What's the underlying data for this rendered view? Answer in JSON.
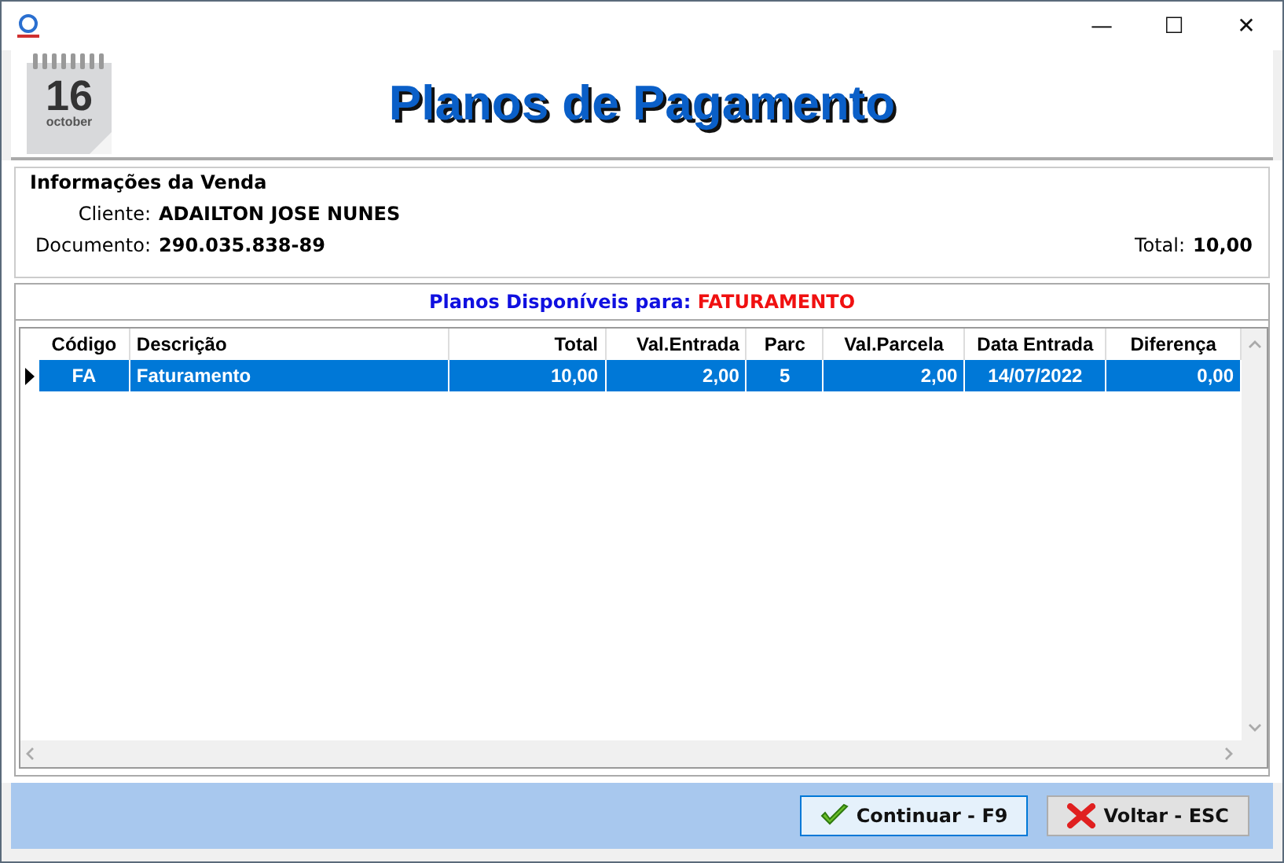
{
  "window": {
    "title": "Planos de Pagamento",
    "controls": [
      "—",
      "☐",
      "✕"
    ]
  },
  "calendar": {
    "day": "16",
    "month": "october"
  },
  "sale_info": {
    "legend": "Informações da Venda",
    "client_label": "Cliente:",
    "client": "ADAILTON JOSE NUNES",
    "document_label": "Documento:",
    "document": "290.035.838-89",
    "total_label": "Total:",
    "total": "10,00"
  },
  "plans": {
    "caption": "Planos Disponíveis para:",
    "caption_value": "FATURAMENTO",
    "columns": [
      "Código",
      "Descrição",
      "Total",
      "Val.Entrada",
      "Parc",
      "Val.Parcela",
      "Data Entrada",
      "Diferença"
    ],
    "rows": [
      {
        "selected": true,
        "cells": [
          "FA",
          "Faturamento",
          "10,00",
          "2,00",
          "5",
          "2,00",
          "14/07/2022",
          "0,00"
        ]
      }
    ]
  },
  "buttons": [
    {
      "kind": "ok",
      "label": "Continuar - F9",
      "selected": true
    },
    {
      "kind": "cancel",
      "label": "Voltar - ESC",
      "selected": false
    }
  ]
}
